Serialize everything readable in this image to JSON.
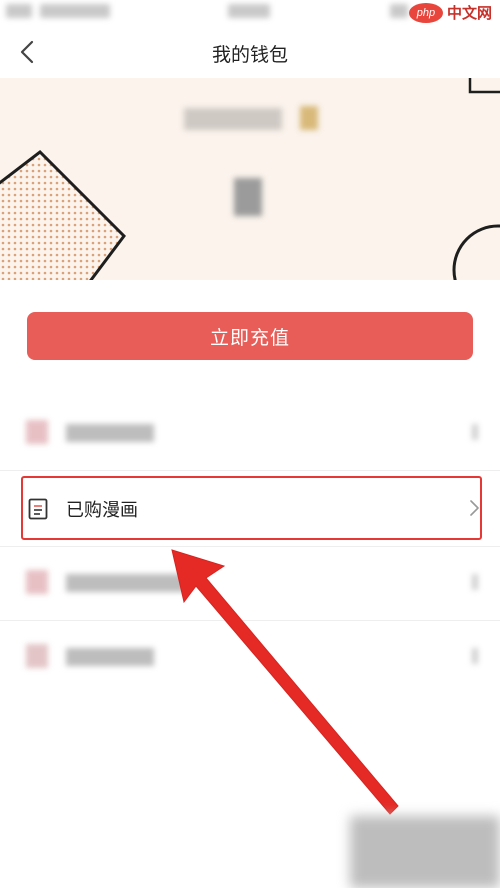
{
  "nav": {
    "title": "我的钱包"
  },
  "watermark": {
    "logo": "php",
    "text": "中文网"
  },
  "recharge": {
    "label": "立即充值"
  },
  "menu": {
    "items": [
      {
        "label": "",
        "blurred": true,
        "icon": "blurred-icon"
      },
      {
        "label": "已购漫画",
        "blurred": false,
        "icon": "document-icon",
        "highlighted": true
      },
      {
        "label": "",
        "blurred": true,
        "icon": "blurred-icon"
      },
      {
        "label": "",
        "blurred": true,
        "icon": "blurred-icon"
      }
    ]
  },
  "colors": {
    "accent": "#e85d57",
    "banner_bg": "#fbf3ec",
    "highlight": "#e53935"
  }
}
